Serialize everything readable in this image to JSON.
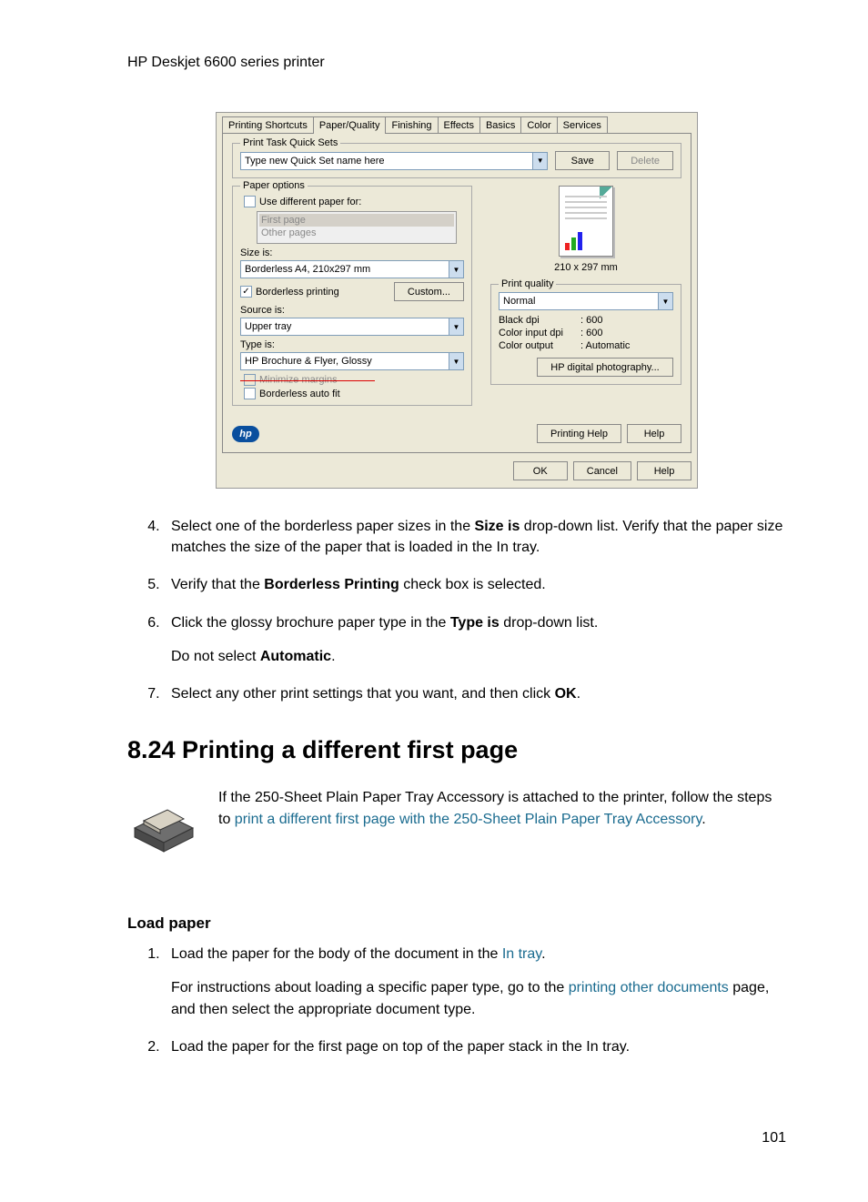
{
  "header": {
    "title": "HP Deskjet 6600 series printer"
  },
  "dialog": {
    "tabs": [
      "Printing Shortcuts",
      "Paper/Quality",
      "Finishing",
      "Effects",
      "Basics",
      "Color",
      "Services"
    ],
    "active_tab": 1,
    "quickset": {
      "legend": "Print Task Quick Sets",
      "value": "Type new Quick Set name here",
      "save_label": "Save",
      "delete_label": "Delete"
    },
    "paper_options": {
      "legend": "Paper options",
      "use_different_label": "Use different paper for:",
      "first_page": "First page",
      "other_pages": "Other pages",
      "size_label": "Size is:",
      "size_value": "Borderless A4, 210x297 mm",
      "borderless_label": "Borderless printing",
      "custom_label": "Custom...",
      "source_label": "Source is:",
      "source_value": "Upper tray",
      "type_label": "Type is:",
      "type_value": "HP Brochure & Flyer, Glossy",
      "minimize_margins": "Minimize margins",
      "autofit_label": "Borderless auto fit"
    },
    "preview": {
      "dimensions": "210 x 297 mm"
    },
    "print_quality": {
      "legend": "Print quality",
      "value": "Normal",
      "black_dpi_label": "Black dpi",
      "black_dpi_value": ": 600",
      "color_input_label": "Color input dpi",
      "color_input_value": ": 600",
      "color_output_label": "Color output",
      "color_output_value": ": Automatic",
      "digital_photo_label": "HP digital photography..."
    },
    "hp_label": "hp",
    "printing_help_label": "Printing Help",
    "help_label": "Help",
    "ok_label": "OK",
    "cancel_label": "Cancel",
    "help2_label": "Help"
  },
  "steps": {
    "s4a": "Select one of the borderless paper sizes in the ",
    "s4b": "Size is",
    "s4c": " drop-down list. Verify that the paper size matches the size of the paper that is loaded in the In tray.",
    "s5a": "Verify that the ",
    "s5b": "Borderless Printing",
    "s5c": " check box is selected.",
    "s6a": "Click the glossy brochure paper type in the ",
    "s6b": "Type is",
    "s6c": " drop-down list.",
    "s6d": "Do not select ",
    "s6e": "Automatic",
    "s6f": ".",
    "s7a": "Select any other print settings that you want, and then click ",
    "s7b": "OK",
    "s7c": "."
  },
  "section": {
    "title": "8.24  Printing a different first page",
    "intro_a": "If the 250-Sheet Plain Paper Tray Accessory is attached to the printer, follow the steps to ",
    "intro_link": "print a different first page with the 250-Sheet Plain Paper Tray Accessory",
    "intro_b": "."
  },
  "load_paper": {
    "heading": "Load paper",
    "l1a": "Load the paper for the body of the document in the ",
    "l1link": "In tray",
    "l1b": ".",
    "l1c": "For instructions about loading a specific paper type, go to the ",
    "l1link2": "printing other documents",
    "l1d": " page, and then select the appropriate document type.",
    "l2": "Load the paper for the first page on top of the paper stack in the In tray."
  },
  "page_number": "101"
}
